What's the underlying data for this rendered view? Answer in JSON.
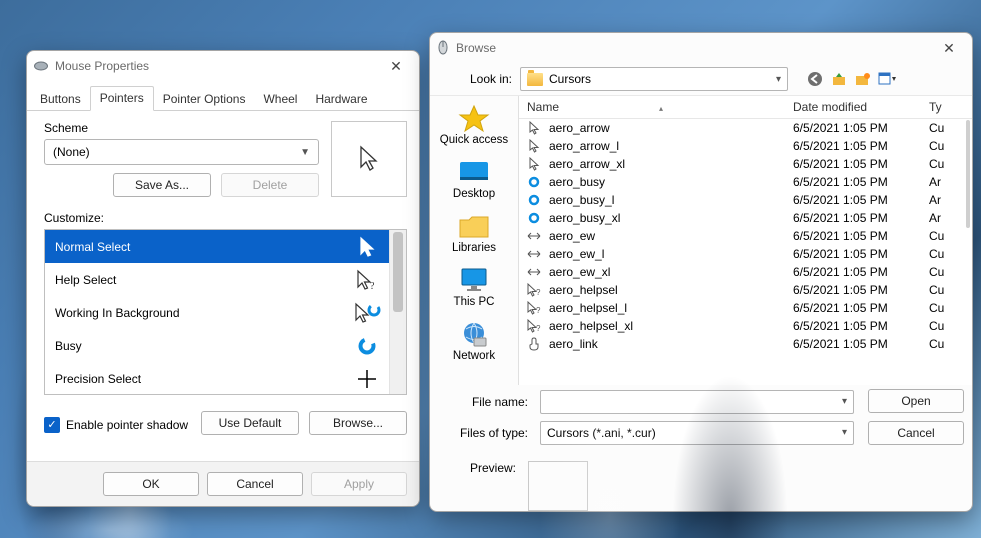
{
  "mouseprops": {
    "title": "Mouse Properties",
    "tabs": [
      "Buttons",
      "Pointers",
      "Pointer Options",
      "Wheel",
      "Hardware"
    ],
    "active_tab": 1,
    "scheme_label": "Scheme",
    "scheme_value": "(None)",
    "save_as_btn": "Save As...",
    "delete_btn": "Delete",
    "customize_label": "Customize:",
    "customize_items": [
      {
        "label": "Normal Select",
        "icon": "arrow",
        "selected": true
      },
      {
        "label": "Help Select",
        "icon": "arrow-help",
        "selected": false
      },
      {
        "label": "Working In Background",
        "icon": "arrow-ring",
        "selected": false
      },
      {
        "label": "Busy",
        "icon": "ring",
        "selected": false
      },
      {
        "label": "Precision Select",
        "icon": "cross",
        "selected": false
      }
    ],
    "shadow_checkbox": {
      "checked": true,
      "label": "Enable pointer shadow"
    },
    "use_default_btn": "Use Default",
    "browse_btn": "Browse...",
    "dialog_buttons": {
      "ok": "OK",
      "cancel": "Cancel",
      "apply": "Apply"
    }
  },
  "browse": {
    "title": "Browse",
    "lookin_label": "Look in:",
    "lookin_value": "Cursors",
    "sidebar": [
      {
        "icon": "star",
        "label": "Quick access"
      },
      {
        "icon": "desktop",
        "label": "Desktop"
      },
      {
        "icon": "folder",
        "label": "Libraries"
      },
      {
        "icon": "pc",
        "label": "This PC"
      },
      {
        "icon": "globe",
        "label": "Network"
      }
    ],
    "columns": {
      "name": "Name",
      "date": "Date modified",
      "type": "Ty"
    },
    "date_value": "6/5/2021 1:05 PM",
    "files": [
      {
        "name": "aero_arrow",
        "icon": "arrow",
        "type": "Cu"
      },
      {
        "name": "aero_arrow_l",
        "icon": "arrow",
        "type": "Cu"
      },
      {
        "name": "aero_arrow_xl",
        "icon": "arrow",
        "type": "Cu"
      },
      {
        "name": "aero_busy",
        "icon": "ring",
        "type": "Ar"
      },
      {
        "name": "aero_busy_l",
        "icon": "ring",
        "type": "Ar"
      },
      {
        "name": "aero_busy_xl",
        "icon": "ring",
        "type": "Ar"
      },
      {
        "name": "aero_ew",
        "icon": "ew",
        "type": "Cu"
      },
      {
        "name": "aero_ew_l",
        "icon": "ew",
        "type": "Cu"
      },
      {
        "name": "aero_ew_xl",
        "icon": "ew",
        "type": "Cu"
      },
      {
        "name": "aero_helpsel",
        "icon": "arrow-help",
        "type": "Cu"
      },
      {
        "name": "aero_helpsel_l",
        "icon": "arrow-help",
        "type": "Cu"
      },
      {
        "name": "aero_helpsel_xl",
        "icon": "arrow-help",
        "type": "Cu"
      },
      {
        "name": "aero_link",
        "icon": "hand",
        "type": "Cu"
      }
    ],
    "file_name_label": "File name:",
    "file_name_value": "",
    "files_of_type_label": "Files of type:",
    "files_of_type_value": "Cursors (*.ani, *.cur)",
    "open_btn": "Open",
    "cancel_btn": "Cancel",
    "preview_label": "Preview:"
  }
}
